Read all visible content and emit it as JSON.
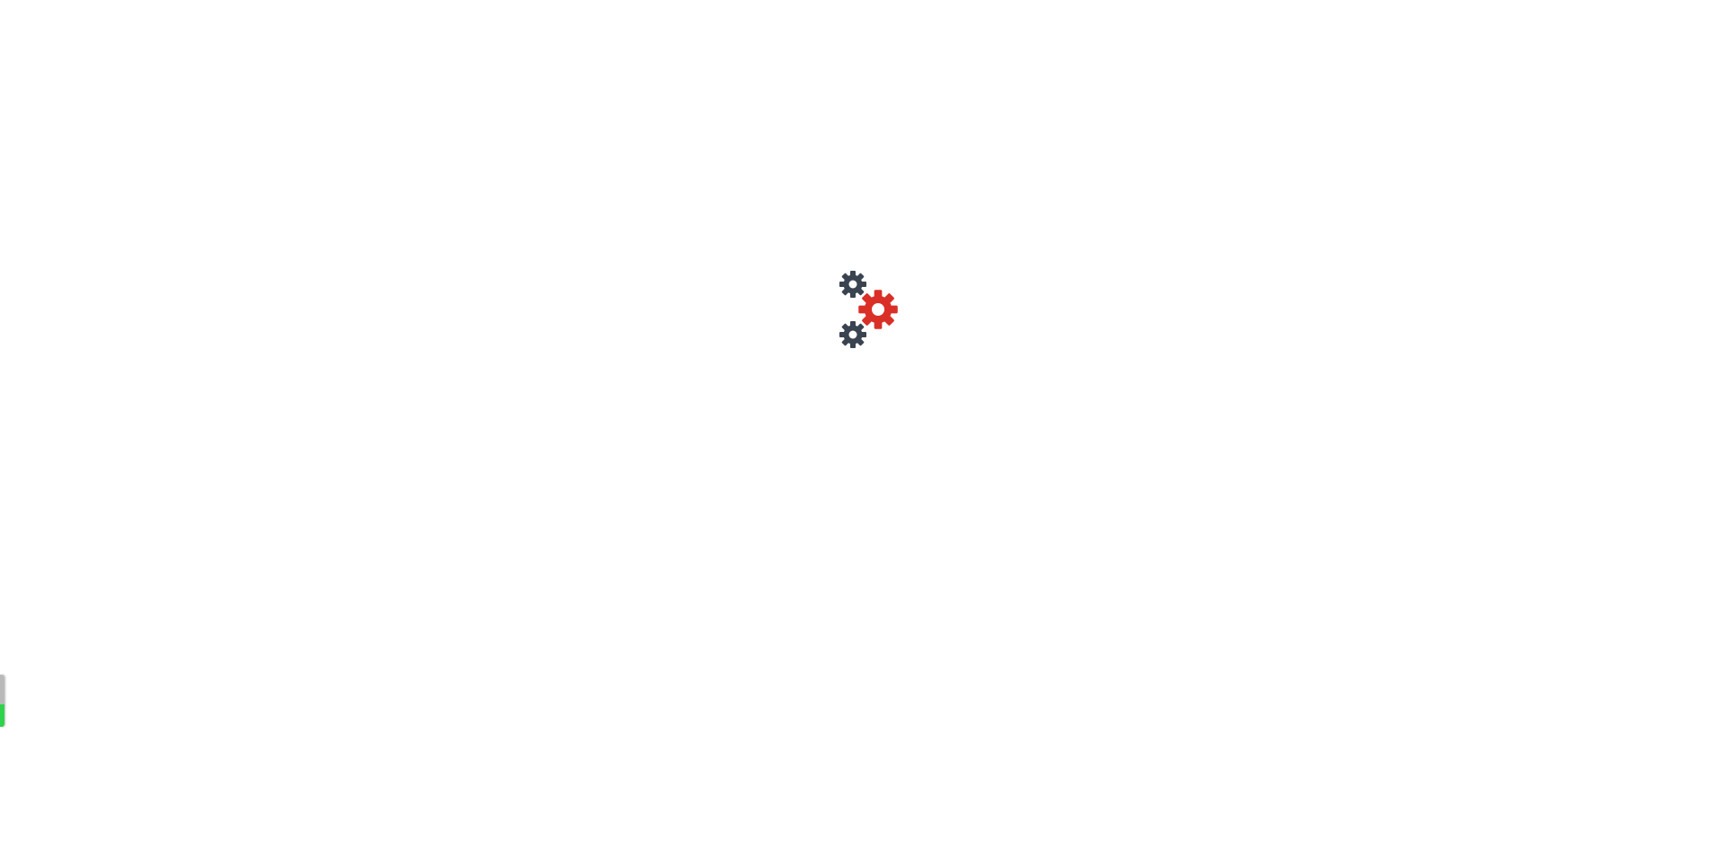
{
  "loader": {
    "icons": [
      "gear-icon",
      "gear-icon",
      "gear-icon"
    ],
    "colors": {
      "small_gear": "#3a4350",
      "large_gear": "#d92f27",
      "background": "#ffffff"
    }
  },
  "side_tab": {
    "colors": {
      "top": "#b9b9b9",
      "bottom": "#2fd24a"
    }
  }
}
